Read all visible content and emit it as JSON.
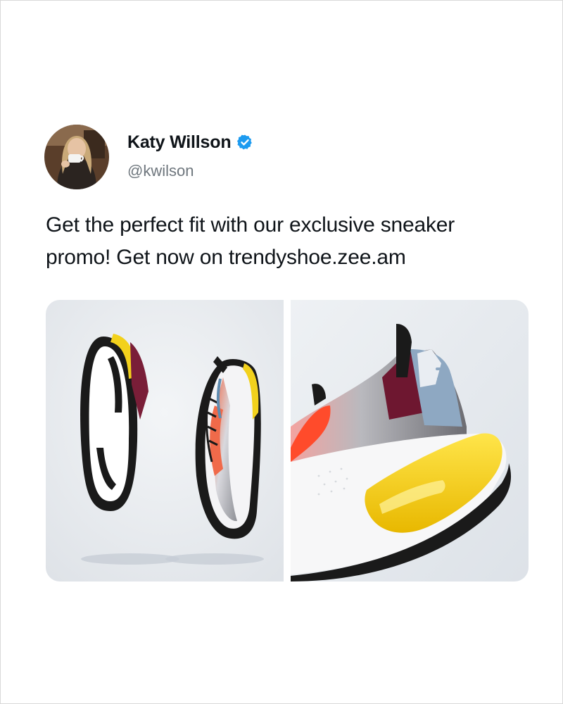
{
  "post": {
    "author": {
      "display_name": "Katy Willson",
      "handle": "@kwilson",
      "verified": true,
      "avatar_icon": "avatar-photo"
    },
    "text": "Get the perfect fit with our exclusive sneaker\npromo! Get now on trendyshoe.zee.am",
    "media": [
      {
        "icon": "sneaker-pair-photo"
      },
      {
        "icon": "sneaker-heel-closeup-photo"
      }
    ]
  },
  "colors": {
    "verified_badge": "#1d9bf0",
    "text_primary": "#0f1419",
    "text_secondary": "#6e767d",
    "photo_background": "#e8ebef",
    "sole_accent": "#f2d11c"
  }
}
